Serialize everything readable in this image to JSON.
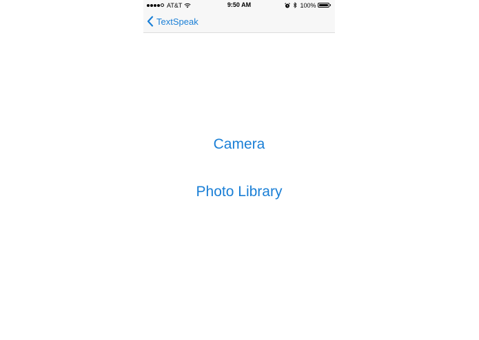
{
  "status_bar": {
    "carrier": "AT&T",
    "time": "9:50 AM",
    "battery_percent": "100%",
    "battery_level": 1.0,
    "signal_bars_filled": 4,
    "signal_bars_total": 5,
    "icons": [
      "wifi-icon",
      "alarm-icon",
      "bluetooth-icon",
      "battery-icon"
    ]
  },
  "nav": {
    "back_label": "TextSpeak"
  },
  "main": {
    "camera_label": "Camera",
    "photo_library_label": "Photo Library"
  },
  "colors": {
    "accent": "#1a7fd6",
    "bar_background": "#f7f7f7",
    "background": "#ffffff"
  }
}
